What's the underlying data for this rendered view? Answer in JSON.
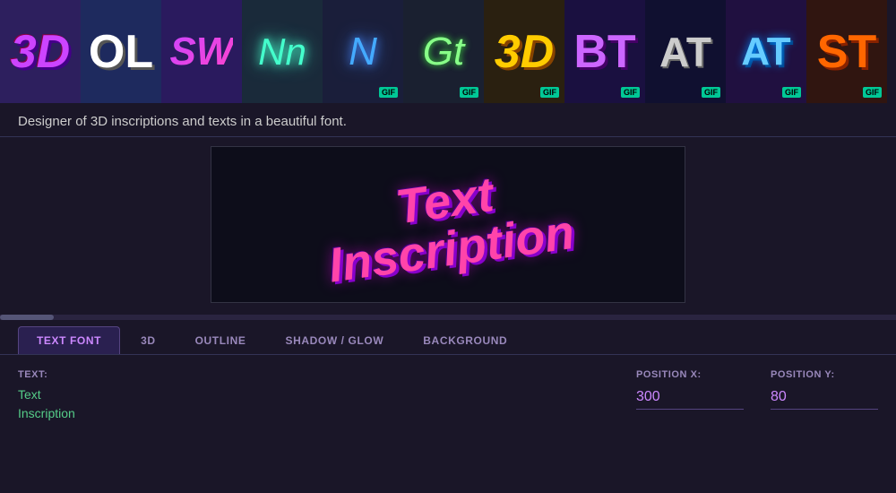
{
  "gallery": {
    "items": [
      {
        "label": "3D",
        "style_class": "gallery-text-3d",
        "has_gif": false
      },
      {
        "label": "OL",
        "style_class": "gallery-text-ol",
        "has_gif": false
      },
      {
        "label": "SW",
        "style_class": "gallery-text-sw",
        "has_gif": false
      },
      {
        "label": "Nn",
        "style_class": "gallery-text-nn",
        "has_gif": false
      },
      {
        "label": "N",
        "style_class": "gallery-text-n2",
        "has_gif": true
      },
      {
        "label": "Gt",
        "style_class": "gallery-text-gt",
        "has_gif": true
      },
      {
        "label": "3D",
        "style_class": "gallery-text-3d2",
        "has_gif": true
      },
      {
        "label": "BT",
        "style_class": "gallery-text-bt",
        "has_gif": true
      },
      {
        "label": "AT",
        "style_class": "gallery-text-at",
        "has_gif": true
      },
      {
        "label": "AT",
        "style_class": "gallery-text-at2",
        "has_gif": true
      },
      {
        "label": "ST",
        "style_class": "gallery-text-st",
        "has_gif": true
      }
    ],
    "gif_label": "GIF"
  },
  "description": "Designer of 3D inscriptions and texts in a beautiful font.",
  "preview": {
    "text_line1": "Text",
    "text_line2": "Inscription"
  },
  "tabs": [
    {
      "id": "text-font",
      "label": "TEXT FONT",
      "active": true
    },
    {
      "id": "3d",
      "label": "3D",
      "active": false
    },
    {
      "id": "outline",
      "label": "OUTLINE",
      "active": false
    },
    {
      "id": "shadow-glow",
      "label": "SHADOW / GLOW",
      "active": false
    },
    {
      "id": "background",
      "label": "BACKGROUND",
      "active": false
    }
  ],
  "controls": {
    "text_label": "TEXT:",
    "text_value_line1": "Text",
    "text_value_line2": "Inscription",
    "position_x_label": "POSITION X:",
    "position_x_value": "300",
    "position_y_label": "POSITION Y:",
    "position_y_value": "80"
  }
}
